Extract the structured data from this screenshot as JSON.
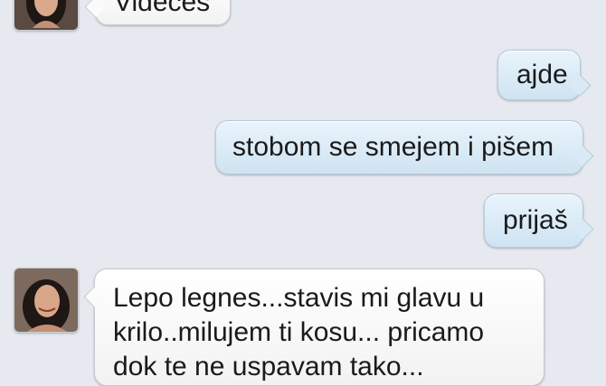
{
  "messages": [
    {
      "direction": "incoming",
      "text": "Videćeš"
    },
    {
      "direction": "outgoing",
      "text": "ajde"
    },
    {
      "direction": "outgoing",
      "text": "stobom se smejem i pišem"
    },
    {
      "direction": "outgoing",
      "text": "prijaš"
    },
    {
      "direction": "incoming",
      "text": "Lepo legnes...stavis mi glavu u\nkrilo..milujem ti kosu... pricamo\ndok te ne uspavam tako..."
    }
  ],
  "colors": {
    "background": "#e6e9ef",
    "outgoing_bubble": "#d9eaf6",
    "incoming_bubble": "#ffffff"
  }
}
